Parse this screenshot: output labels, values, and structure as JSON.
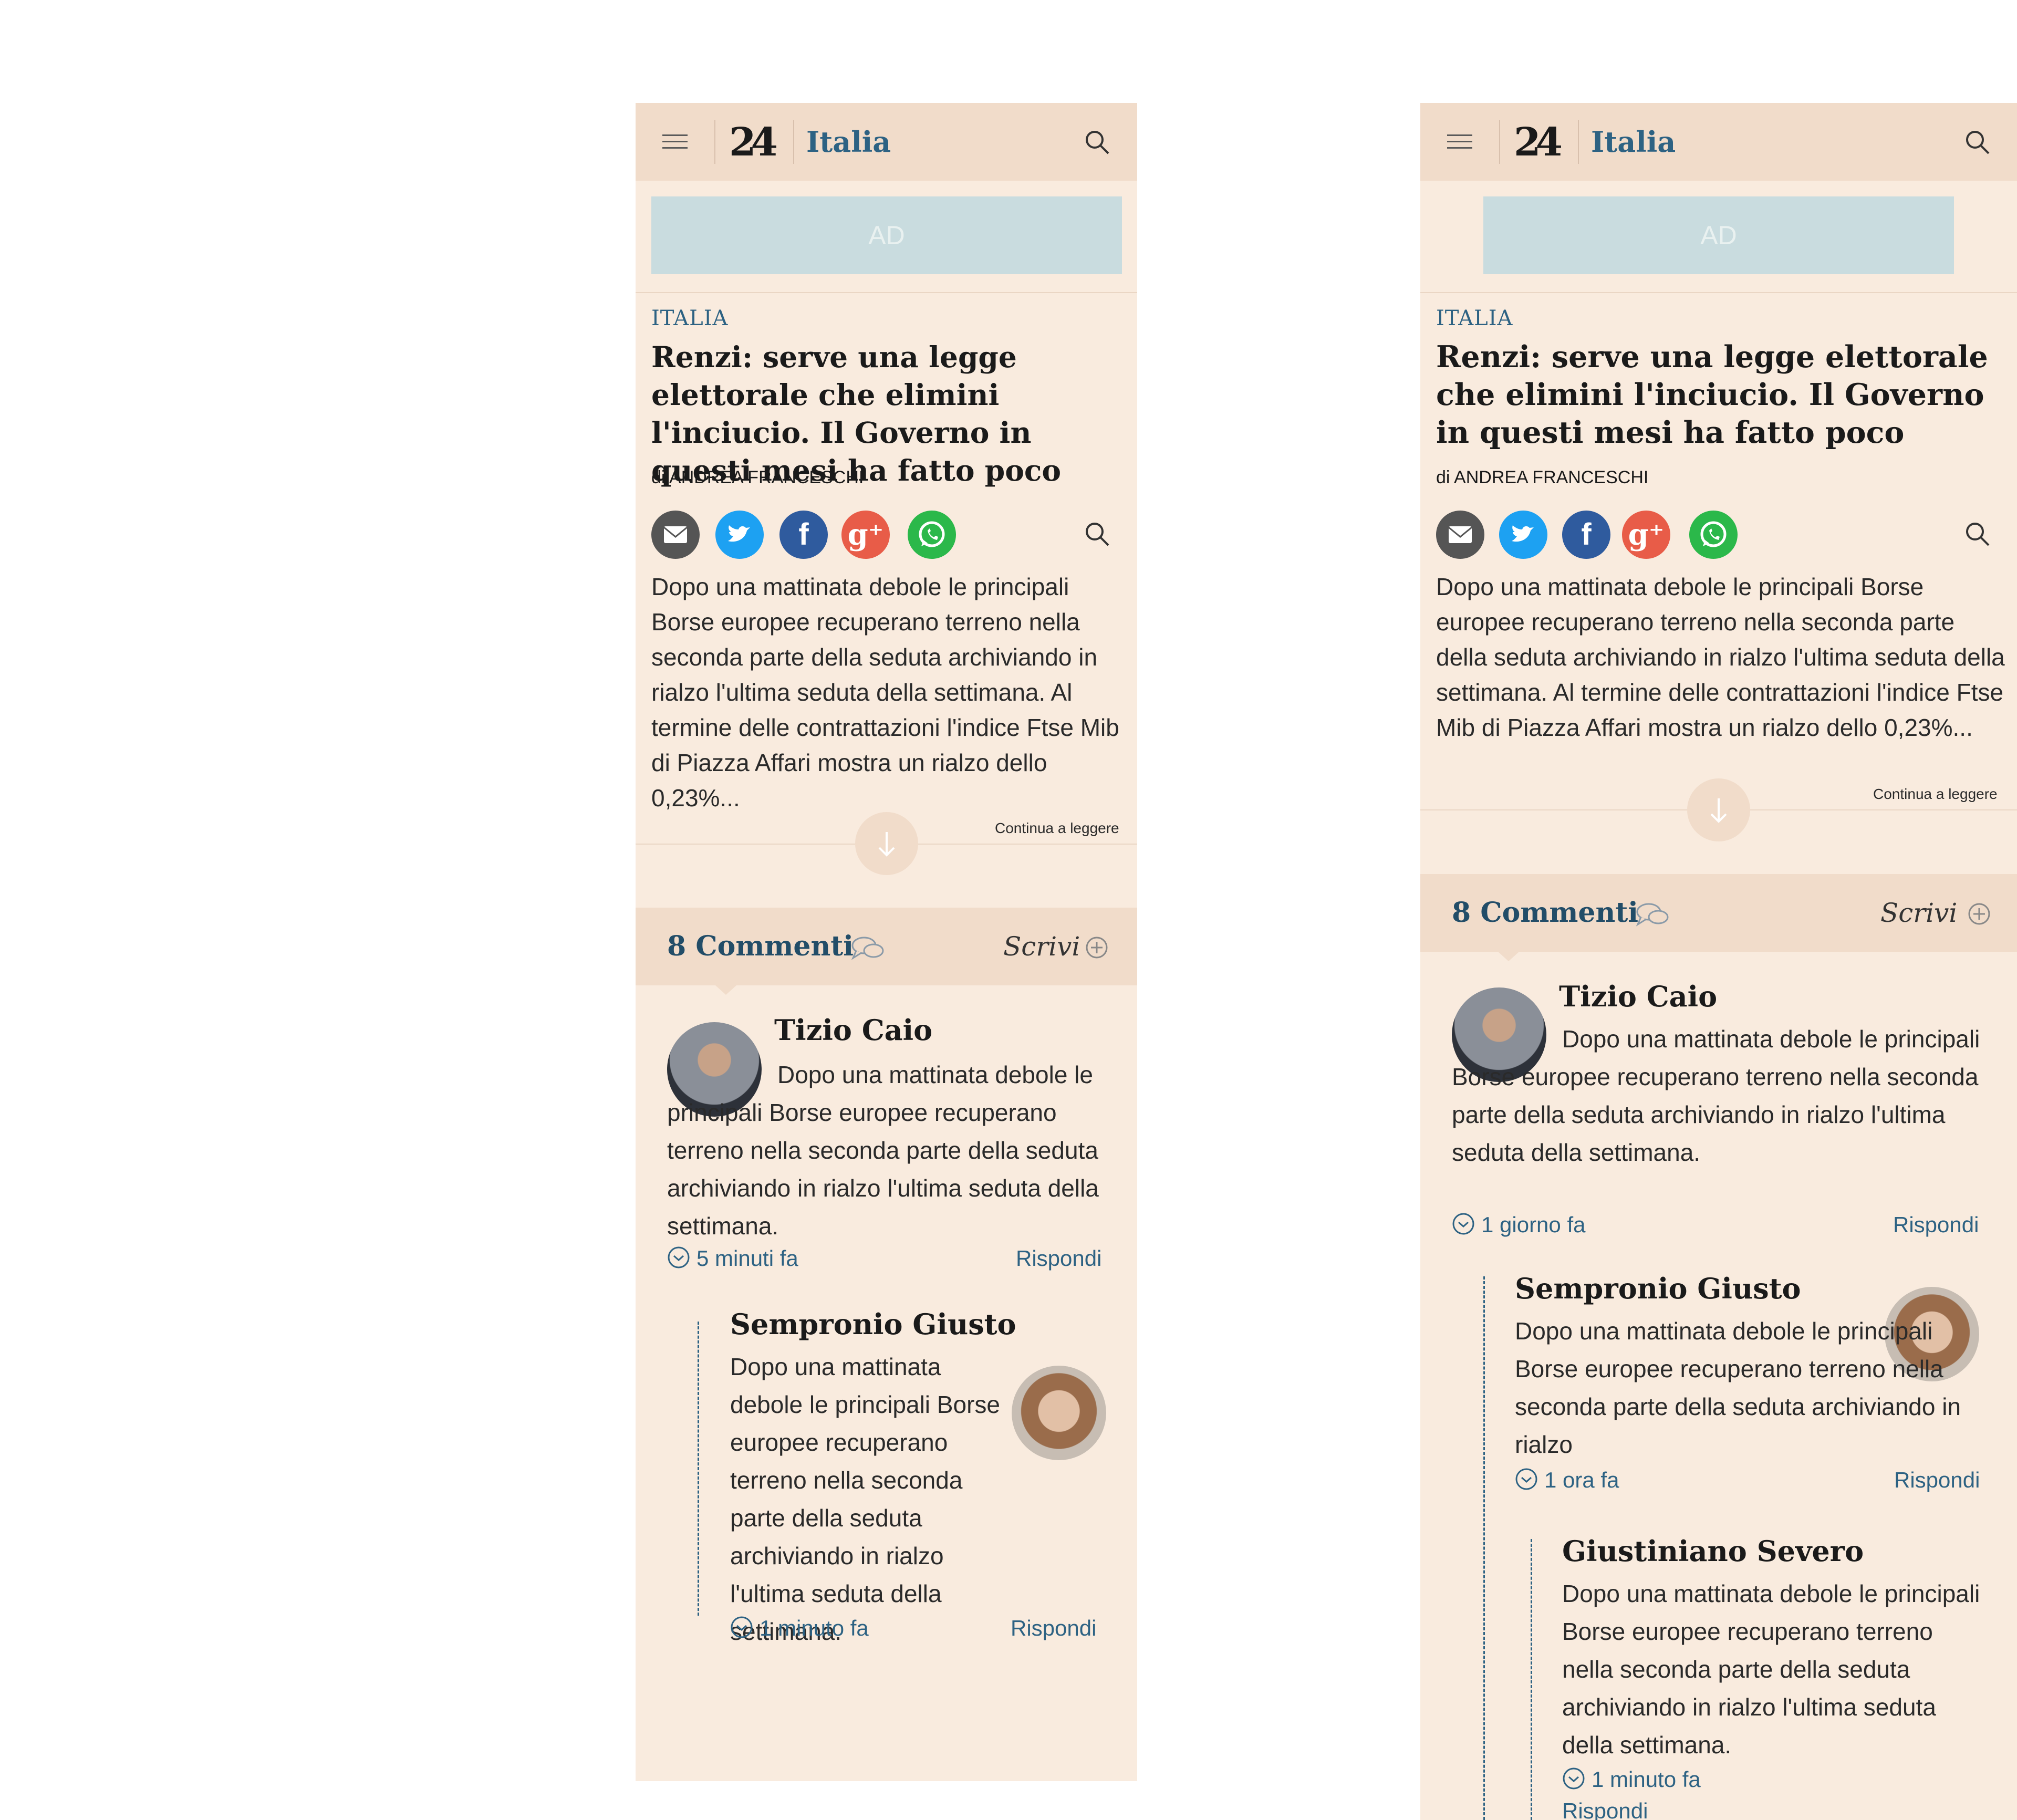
{
  "header": {
    "logo": "24",
    "section": "Italia"
  },
  "ad": {
    "label": "AD"
  },
  "article": {
    "kicker": "ITALIA",
    "headline": "Renzi: serve una legge elettorale che elimini l'inciucio. Il Governo in questi mesi ha fatto poco",
    "byline": "di ANDREA FRANCESCHI",
    "excerpt": "Dopo una mattinata debole le principali Borse europee recuperano terreno nella seconda parte della seduta archiviando in rialzo l'ultima seduta della settimana. Al termine delle contrattazioni l'indice Ftse Mib di Piazza Affari mostra un rialzo dello 0,23%...",
    "continue": "Continua a leggere",
    "share_icons": [
      "mail-icon",
      "twitter-icon",
      "facebook-icon",
      "google-plus-icon",
      "whatsapp-icon"
    ]
  },
  "comments_bar": {
    "title": "8 Commenti",
    "write": "Scrivi"
  },
  "colors": {
    "background": "#f9ebde",
    "header": "#f1dcca",
    "accent": "#2d6283",
    "ad": "#c9dcdf"
  },
  "variant_a": {
    "comments": [
      {
        "name": "Tizio Caio",
        "text": "Dopo una mattinata debole le principali Borse europee recuperano terreno nella seconda parte della seduta archiviando in rialzo l'ultima seduta della settimana.",
        "time": "5 minuti fa",
        "reply": "Rispondi"
      },
      {
        "name": "Sempronio Giusto",
        "text": "Dopo una mattinata debole le principali Borse europee recuperano terreno nella seconda parte della seduta archiviando in rialzo l'ultima seduta della settimana.",
        "time": "1 minuto fa",
        "reply": "Rispondi"
      }
    ]
  },
  "variant_b": {
    "comments": [
      {
        "name": "Tizio Caio",
        "text": "Dopo una mattinata debole le principali Borse europee recuperano terreno nella seconda parte della seduta archiviando in rialzo l'ultima seduta della settimana.",
        "time": "1 giorno fa",
        "reply": "Rispondi"
      },
      {
        "name": "Sempronio Giusto",
        "text": "Dopo una mattinata debole le principali Borse europee recuperano terreno nella seconda parte della seduta archiviando in rialzo",
        "time": "1 ora fa",
        "reply": "Rispondi"
      },
      {
        "name": "Giustiniano Severo",
        "text": "Dopo una mattinata debole le principali Borse europee recuperano terreno nella seconda parte della seduta archiviando in rialzo l'ultima seduta della settimana.",
        "time": "1 minuto fa",
        "reply": "Rispondi"
      }
    ]
  }
}
